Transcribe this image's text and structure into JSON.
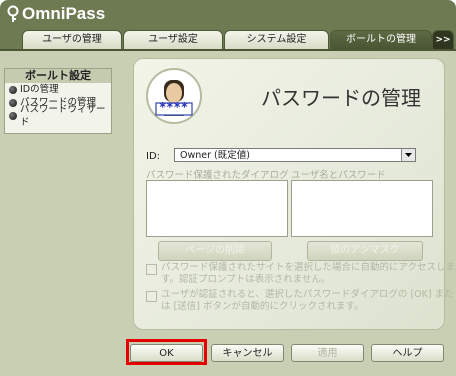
{
  "app": {
    "name": "OmniPass"
  },
  "tabs": [
    {
      "label": "ユーザの管理"
    },
    {
      "label": "ユーザ設定"
    },
    {
      "label": "システム設定"
    },
    {
      "label": "ボールトの管理"
    },
    {
      "label": ">>"
    }
  ],
  "sidebar": {
    "title": "ボールト設定",
    "items": [
      {
        "label": "IDの管理"
      },
      {
        "label": "パスワードの管理"
      },
      {
        "label": "パスワードウィザード"
      }
    ]
  },
  "panel": {
    "title": "パスワードの管理",
    "avatar_badge": "****",
    "id_label": "ID:",
    "id_value": "Owner (既定値)",
    "list1_label": "パスワード保護されたダイアログ",
    "list2_label": "ユーザ名とパスワード",
    "delete_page_button": "ページの削除",
    "unmask_button": "値のアンマスク",
    "checkbox1_text": "パスワード保護されたサイトを選択した場合に自動的にアクセスします。認証プロンプトは表示されません。",
    "checkbox2_text": "ユーザが認証されると、選択したパスワードダイアログの [OK] または [送信] ボタンが自動的にクリックされます。"
  },
  "footer": {
    "ok": "OK",
    "cancel": "キャンセル",
    "apply": "適用",
    "help": "ヘルプ"
  },
  "colors": {
    "frame": "#6d7a52",
    "content_bg": "#c8cfb2",
    "active_tab": "#4a5634",
    "highlight": "#e40000"
  }
}
